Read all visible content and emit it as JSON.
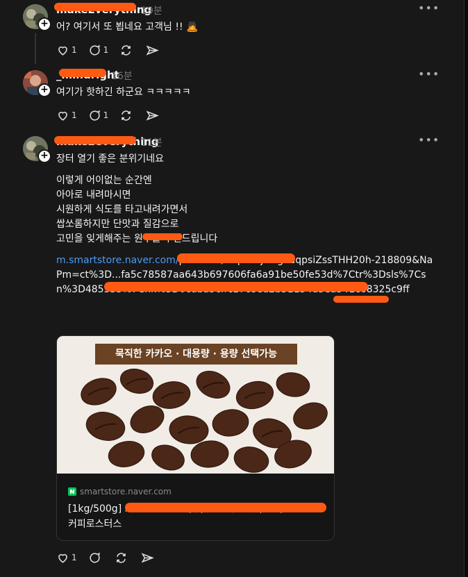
{
  "posts": [
    {
      "username": "makeEverything",
      "time": "19분",
      "text": "어? 여기서 또 뵙네요 고객님 !! 🙇",
      "likes": "1",
      "replies": "1"
    },
    {
      "username": "_mindright",
      "time": "16분",
      "text": "여기가 핫하긴 하군요 ㅋㅋㅋㅋㅋ",
      "likes": "1",
      "replies": "1"
    },
    {
      "username": "make2everything",
      "time": "11분",
      "text": "장터 열기 좋은 분위기네요",
      "body_lines": [
        "이렇게 어이없는 순간엔",
        "아아로 내려마시면",
        "시원하게 식도를 타고내려가면서",
        "쌉쏘롬하지만 단맛과 질감으로",
        "고민을 잊게해주는 원두를 추천드립니다"
      ],
      "link_prefix": "m.smartstore.naver.com/",
      "link_rest": "products/...-pid=jO8gPdqpsiZssTHH20h-218809&NaPm=ct%3D...fa5c78587aa643b697606fa6a91be50fe53d%7Ctr%3Dsls%7Csn%3D485535%7Chk%3D0cdba5cffc17c8ed2b31154d3ea541c68325c9ff",
      "card": {
        "banner": "묵직한 카카오 · 대용량 · 용량 선택가능",
        "domain": "smartstore.naver.com",
        "title": "[1kg/500g] 모노 등 블렌드 (구) 스모키 원두 (홀빈) 1+그램 커피로스터스"
      },
      "likes": "1",
      "replies": ""
    }
  ],
  "icons": {
    "more": "more-dots-icon",
    "like": "heart-icon",
    "reply": "comment-icon",
    "repost": "repost-icon",
    "share": "send-icon",
    "add": "plus-icon",
    "site": "naver-favicon-icon"
  }
}
